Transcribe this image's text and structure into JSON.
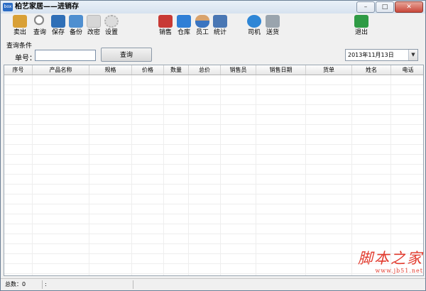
{
  "window": {
    "title": "柏艺家居——进销存",
    "app_icon_text": "box",
    "buttons": {
      "minimize": "–",
      "maximize": "□",
      "close": "✕"
    }
  },
  "toolbar": {
    "items": [
      {
        "label": "卖出",
        "icon": "cart-icon",
        "color": "#d9a036"
      },
      {
        "label": "查询",
        "icon": "magnifier-icon",
        "color": "#8a8a8a"
      },
      {
        "label": "保存",
        "icon": "save-icon",
        "color": "#2f6fb7"
      },
      {
        "label": "备份",
        "icon": "folder-backup-icon",
        "color": "#4f8fd0"
      },
      {
        "label": "改密",
        "icon": "lock-icon",
        "color": "#b9b9b9"
      },
      {
        "label": "设置",
        "icon": "gear-icon",
        "color": "#b0b0b0"
      },
      {
        "label": "销售",
        "icon": "basket-icon",
        "color": "#c83a35"
      },
      {
        "label": "仓库",
        "icon": "box-icon",
        "color": "#2f7fd6"
      },
      {
        "label": "员工",
        "icon": "person-icon",
        "color": "#d9a36c"
      },
      {
        "label": "统计",
        "icon": "chart-icon",
        "color": "#4a77b4"
      },
      {
        "label": "司机",
        "icon": "driver-icon",
        "color": "#2e86d6"
      },
      {
        "label": "送货",
        "icon": "truck-icon",
        "color": "#9aa4ad"
      },
      {
        "label": "退出",
        "icon": "exit-icon",
        "color": "#2f9b45"
      }
    ]
  },
  "query": {
    "section_title": "查询条件",
    "order_label": "单号：",
    "order_value": "",
    "search_button": "查询",
    "date_value": "2013年11月13日",
    "date_dropdown_glyph": "▼"
  },
  "grid": {
    "columns": [
      "序号",
      "产品名称",
      "规格",
      "价格",
      "数量",
      "总价",
      "销售员",
      "销售日期",
      "货单",
      "姓名",
      "电话"
    ],
    "rows": []
  },
  "status": {
    "total_label": "总数：0",
    "cell2": ":"
  },
  "watermark": {
    "text": "脚本之家",
    "url": "www.jb51.net"
  }
}
